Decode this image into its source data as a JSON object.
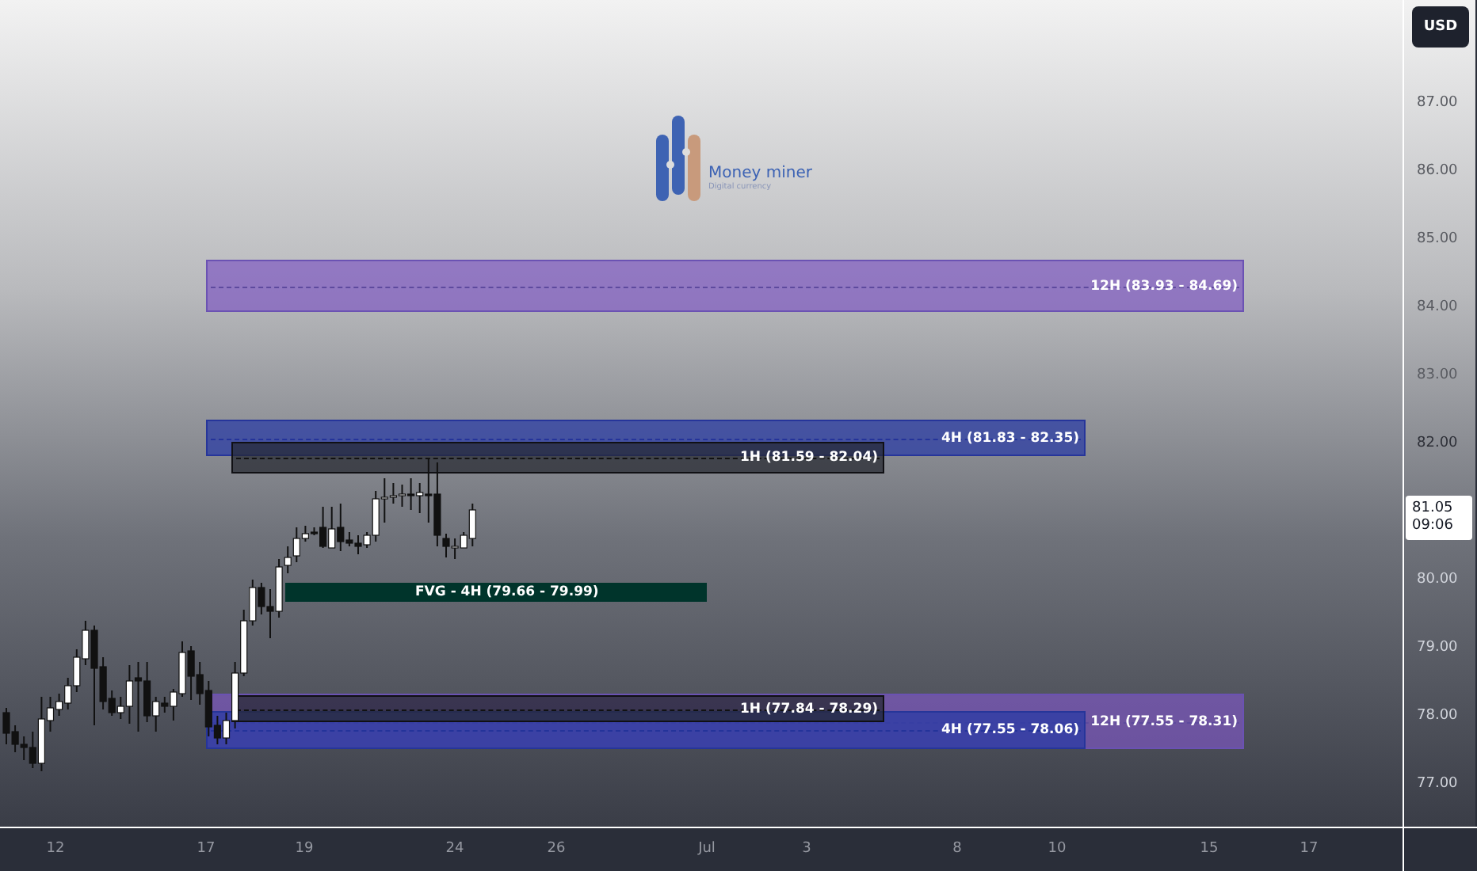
{
  "currency_button": "USD",
  "logo": {
    "name": "Money miner",
    "tagline": "Digital currency"
  },
  "zones": [
    {
      "kind": "large",
      "label": "12H (83.93 - 84.69)"
    },
    {
      "kind": "medium",
      "label": "4H (81.83 - 82.35)"
    },
    {
      "kind": "small",
      "label": "1H (81.59 - 82.04)"
    },
    {
      "kind": "fvg",
      "label": "FVG - 4H (79.66 - 79.99)"
    },
    {
      "kind": "large",
      "label": "12H (77.55 - 78.31)"
    },
    {
      "kind": "medium",
      "label": "4H (77.55 - 78.06)"
    },
    {
      "kind": "small",
      "label": "1H (77.84 - 78.29)"
    }
  ],
  "price_scale": {
    "ticks": [
      "87.00",
      "86.00",
      "85.00",
      "84.00",
      "83.00",
      "82.00",
      "80.00",
      "79.00",
      "78.00",
      "77.00"
    ],
    "current_price": "81.05",
    "countdown": "09:06"
  },
  "time_scale": {
    "ticks": [
      "12",
      "17",
      "19",
      "24",
      "26",
      "Jul",
      "3",
      "8",
      "10",
      "15",
      "17"
    ]
  }
}
